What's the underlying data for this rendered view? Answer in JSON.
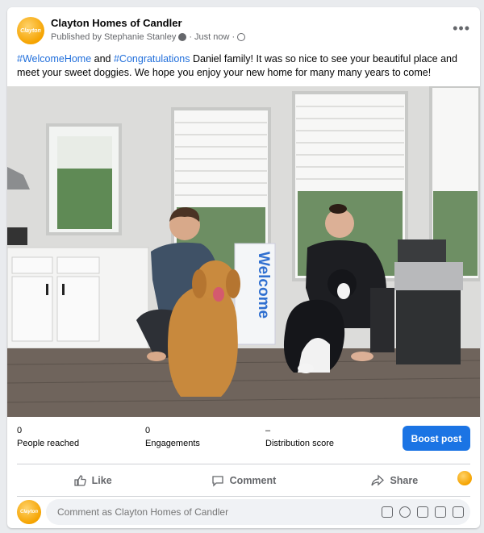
{
  "post": {
    "page_name": "Clayton Homes of Candler",
    "avatar_text": "Clayton",
    "published_by": "Published by Stephanie Stanley",
    "time": "Just now",
    "separator": "·",
    "more": "•••",
    "caption_tag1": "#WelcomeHome",
    "caption_and": " and ",
    "caption_tag2": "#Congratulations",
    "caption_rest": " Daniel family!  It was so nice to see your beautiful place and meet your sweet doggies.  We hope you enjoy your new home for many many years to come!",
    "sign_text": "Welcome"
  },
  "stats": {
    "reached_value": "0",
    "reached_label": "People reached",
    "engagements_value": "0",
    "engagements_label": "Engagements",
    "distribution_value": "–",
    "distribution_label": "Distribution score",
    "boost_label": "Boost post"
  },
  "actions": {
    "like": "Like",
    "comment": "Comment",
    "share": "Share"
  },
  "comment_box": {
    "placeholder": "Comment as Clayton Homes of Candler"
  },
  "colors": {
    "accent": "#1b74e4",
    "hashtag": "#216fdb",
    "brand": "#f5a300"
  }
}
